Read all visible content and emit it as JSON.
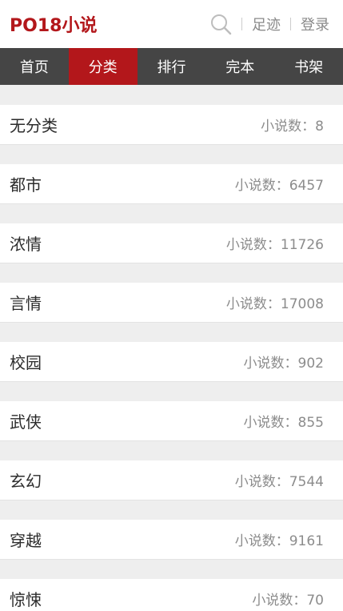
{
  "header": {
    "logo": "PO18小说",
    "footprint_label": "足迹",
    "login_label": "登录"
  },
  "nav": {
    "items": [
      {
        "label": "首页"
      },
      {
        "label": "分类",
        "active": true
      },
      {
        "label": "排行"
      },
      {
        "label": "完本"
      },
      {
        "label": "书架"
      }
    ]
  },
  "categories": [
    {
      "name": "无分类",
      "count": "小说数：8"
    },
    {
      "name": "都市",
      "count": "小说数：6457"
    },
    {
      "name": "浓情",
      "count": "小说数：11726"
    },
    {
      "name": "言情",
      "count": "小说数：17008"
    },
    {
      "name": "校园",
      "count": "小说数：902"
    },
    {
      "name": "武侠",
      "count": "小说数：855"
    },
    {
      "name": "玄幻",
      "count": "小说数：7544"
    },
    {
      "name": "穿越",
      "count": "小说数：9161"
    },
    {
      "name": "惊悚",
      "count": "小说数：70"
    }
  ],
  "colors": {
    "brand": "#b3171b",
    "nav_bg": "#454545"
  },
  "icons": [
    "search-icon"
  ]
}
